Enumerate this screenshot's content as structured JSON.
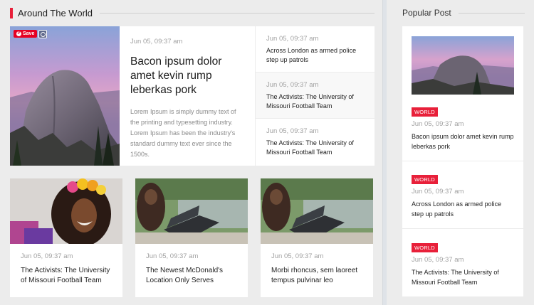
{
  "around": {
    "title": "Around The World",
    "save_label": "Save",
    "featured": {
      "date": "Jun 05, 09:37 am",
      "headline": "Bacon ipsum dolor amet kevin rump leberkas pork",
      "excerpt": "Lorem Ipsum is simply dummy text of the printing and typesetting industry. Lorem Ipsum has been the industry's standard dummy text ever since the 1500s."
    },
    "side_items": [
      {
        "date": "Jun 05, 09:37 am",
        "title": "Across London as armed police step up patrols"
      },
      {
        "date": "Jun 05, 09:37 am",
        "title": "The Activists: The University of Missouri Football Team"
      },
      {
        "date": "Jun 05, 09:37 am",
        "title": "The Activists: The University of Missouri Football Team"
      }
    ],
    "cards": [
      {
        "date": "Jun 05, 09:37 am",
        "title": "The Activists: The University of Missouri Football Team"
      },
      {
        "date": "Jun 05, 09:37 am",
        "title": "The Newest McDonald's Location Only Serves"
      },
      {
        "date": "Jun 05, 09:37 am",
        "title": "Morbi rhoncus, sem laoreet tempus pulvinar leo"
      }
    ]
  },
  "popular": {
    "title": "Popular Post",
    "items": [
      {
        "badge": "WORLD",
        "date": "Jun 05, 09:37 am",
        "title": "Bacon ipsum dolor amet kevin rump leberkas pork"
      },
      {
        "badge": "WORLD",
        "date": "Jun 05, 09:37 am",
        "title": "Across London as armed police step up patrols"
      },
      {
        "badge": "WORLD",
        "date": "Jun 05, 09:37 am",
        "title": "The Activists: The University of Missouri Football Team"
      }
    ]
  },
  "colors": {
    "accent": "#e8203a",
    "pinterest": "#e60023",
    "background": "#ececec"
  },
  "icons": {
    "save": "pinterest-icon",
    "lens": "visual-search-icon"
  }
}
